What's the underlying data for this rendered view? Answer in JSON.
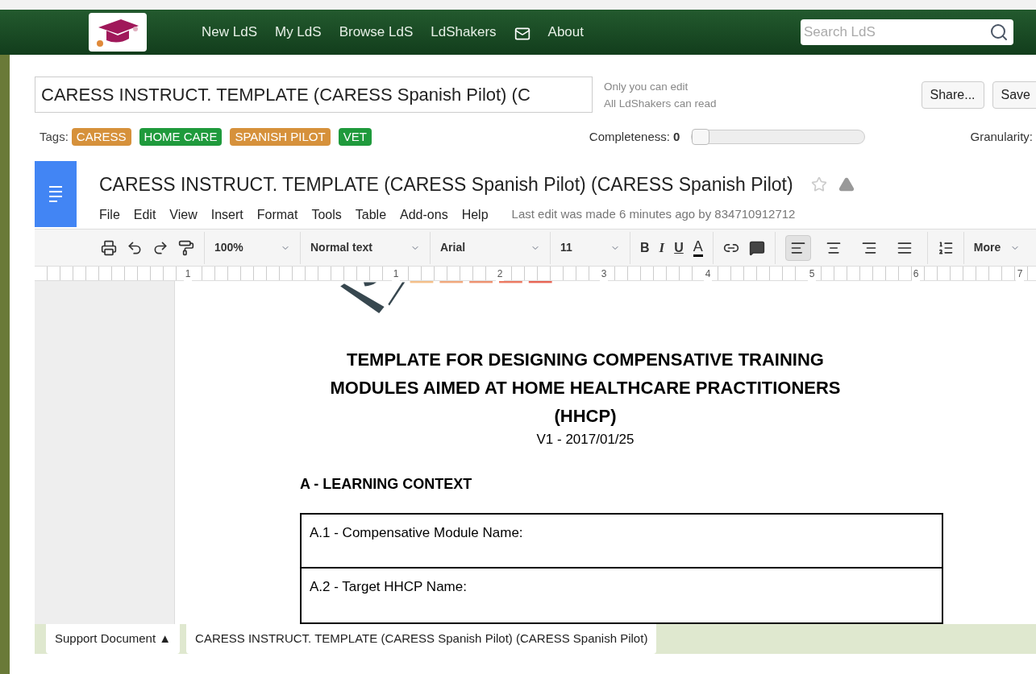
{
  "nav": {
    "items": [
      {
        "kind": "link",
        "label": "New LdS"
      },
      {
        "kind": "link",
        "label": "My LdS"
      },
      {
        "kind": "link",
        "label": "Browse LdS"
      },
      {
        "kind": "link",
        "label": "LdShakers"
      },
      {
        "kind": "mail"
      },
      {
        "kind": "link",
        "label": "About"
      }
    ],
    "search": {
      "placeholder": "Search LdS"
    }
  },
  "editor": {
    "title": {
      "value": "CARESS INSTRUCT. TEMPLATE (CARESS Spanish Pilot) (C"
    },
    "permissions": [
      "Only you can edit",
      "All LdShakers can read"
    ],
    "buttons": [
      "Share...",
      "Save"
    ],
    "tags_label": "Tags:",
    "tags": [
      {
        "label": "CARESS",
        "color": "#d6913b"
      },
      {
        "label": "HOME CARE",
        "color": "#1f9a3c"
      },
      {
        "label": "SPANISH PILOT",
        "color": "#d6913b"
      },
      {
        "label": "VET",
        "color": "#1f9a3c"
      }
    ],
    "completeness": {
      "label": "Completeness:",
      "value": "0",
      "level": 0
    },
    "granularity": {
      "label": "Granularity:"
    }
  },
  "doc": {
    "title": "CARESS INSTRUCT. TEMPLATE (CARESS Spanish Pilot) (CARESS Spanish Pilot)",
    "menus": [
      "File",
      "Edit",
      "View",
      "Insert",
      "Format",
      "Tools",
      "Table",
      "Add-ons",
      "Help"
    ],
    "last_edit": "Last edit was made 6 minutes ago by 834710912712",
    "toolbar": {
      "zoom": "100%",
      "style": "Normal text",
      "font": "Arial",
      "size": "11",
      "bold": "B",
      "italic": "I",
      "underline": "U",
      "text_color": "A",
      "align": [
        {
          "selected": true
        },
        {
          "selected": false
        },
        {
          "selected": false
        },
        {
          "selected": false
        }
      ],
      "more": "More"
    },
    "ruler": [
      "1",
      "1",
      "2",
      "3",
      "4",
      "5",
      "6",
      "7"
    ],
    "heading": [
      "TEMPLATE FOR DESIGNING COMPENSATIVE TRAINING",
      "MODULES AIMED AT HOME HEALTHCARE PRACTITIONERS",
      "(HHCP)"
    ],
    "version": "V1 - 2017/01/25",
    "section": "A - LEARNING CONTEXT",
    "table_rows": [
      "A.1 - Compensative Module Name:",
      "A.2 - Target HHCP Name:"
    ]
  },
  "bottom_tabs": [
    {
      "label": "Support Document ▲"
    },
    {
      "label": "CARESS INSTRUCT. TEMPLATE (CARESS Spanish Pilot) (CARESS Spanish Pilot)"
    }
  ]
}
